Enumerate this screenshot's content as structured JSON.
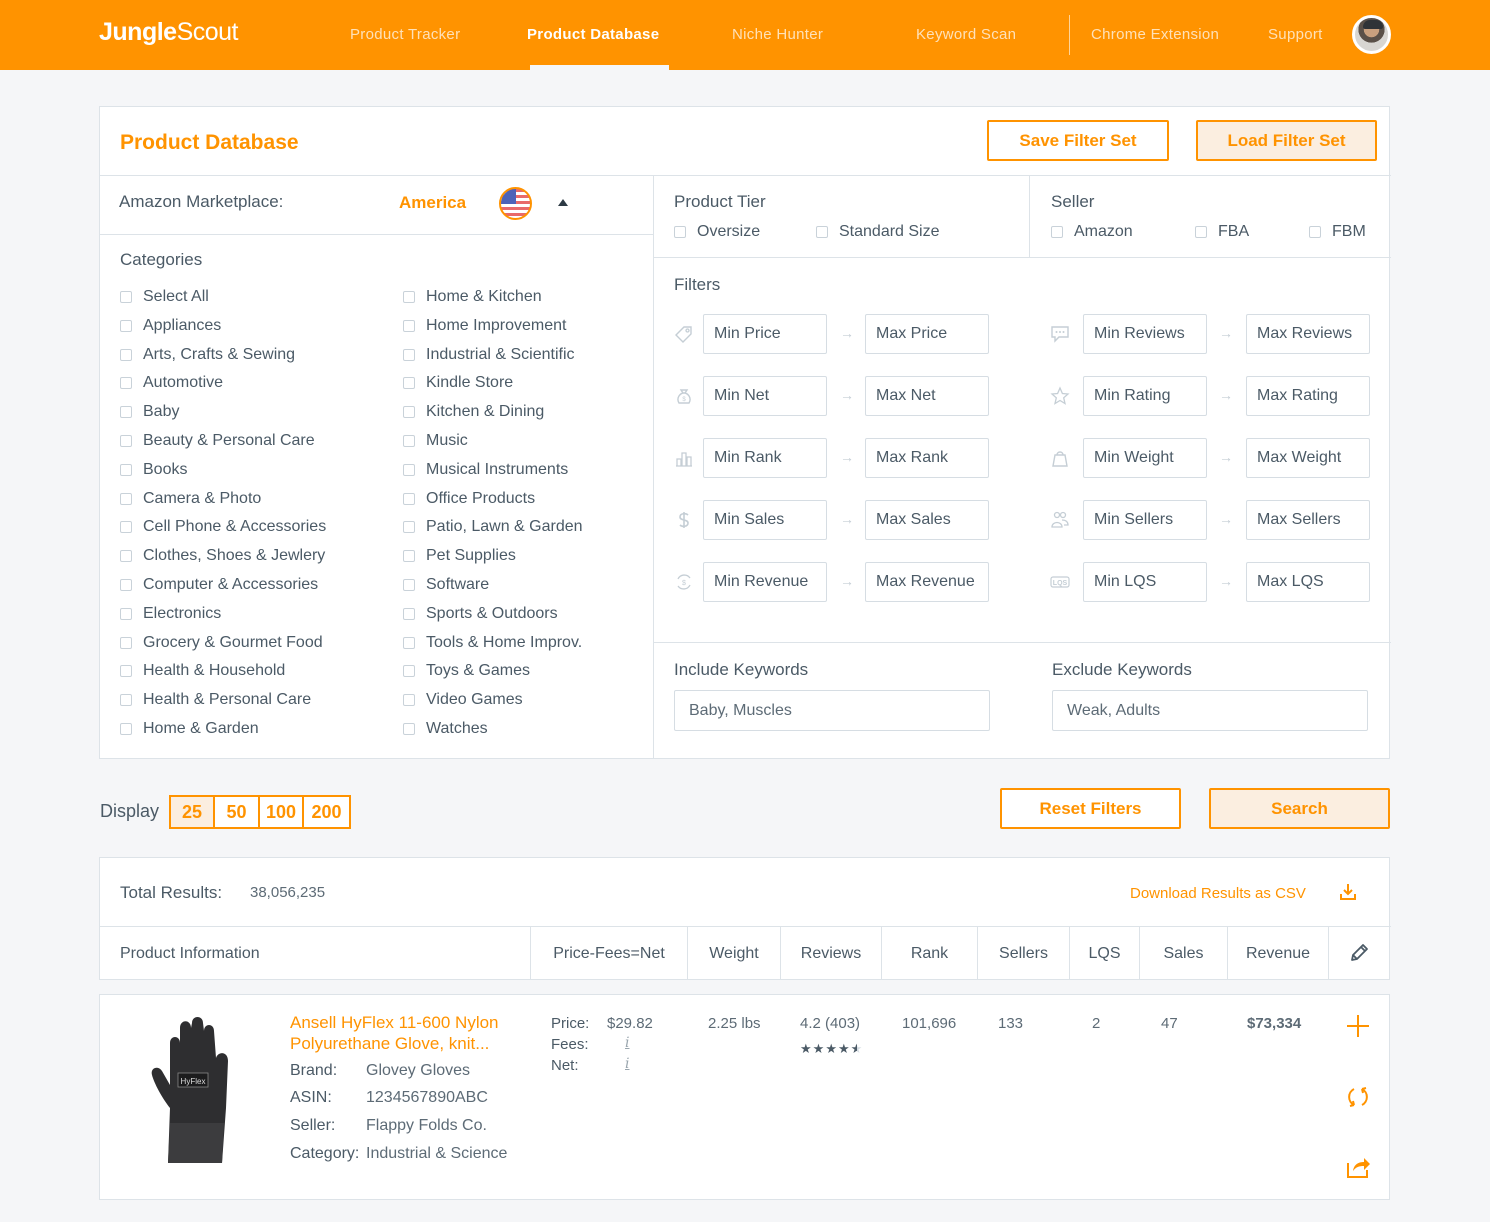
{
  "brand": {
    "logo_bold": "Jungle",
    "logo_light": "Scout",
    "accent": "#ff9300"
  },
  "nav": {
    "items": [
      {
        "label": "Product Tracker",
        "active": false
      },
      {
        "label": "Product Database",
        "active": true
      },
      {
        "label": "Niche Hunter",
        "active": false
      },
      {
        "label": "Keyword Scan",
        "active": false
      },
      {
        "label": "Chrome Extension",
        "active": false
      },
      {
        "label": "Support",
        "active": false
      }
    ],
    "avatar": "user-avatar"
  },
  "filters_panel": {
    "title": "Product Database",
    "save_label": "Save Filter Set",
    "load_label": "Load Filter Set",
    "marketplace_label": "Amazon Marketplace:",
    "marketplace_value": "America",
    "marketplace_flag": "us-flag-icon",
    "categories_title": "Categories",
    "categories_left": [
      "Select All",
      "Appliances",
      "Arts, Crafts & Sewing",
      "Automotive",
      "Baby",
      "Beauty & Personal Care",
      "Books",
      "Camera & Photo",
      "Cell Phone & Accessories",
      "Clothes, Shoes & Jewlery",
      "Computer & Accessories",
      "Electronics",
      "Grocery & Gourmet Food",
      "Health & Household",
      "Health & Personal Care",
      "Home & Garden"
    ],
    "categories_right": [
      "Home & Kitchen",
      "Home Improvement",
      "Industrial & Scientific",
      "Kindle Store",
      "Kitchen & Dining",
      "Music",
      "Musical Instruments",
      "Office Products",
      "Patio, Lawn & Garden",
      "Pet Supplies",
      "Software",
      "Sports & Outdoors",
      "Tools & Home Improv.",
      "Toys & Games",
      "Video Games",
      "Watches"
    ],
    "product_tier": {
      "title": "Product Tier",
      "options": [
        "Oversize",
        "Standard Size"
      ]
    },
    "seller": {
      "title": "Seller",
      "options": [
        "Amazon",
        "FBA",
        "FBM"
      ]
    },
    "filters_title": "Filters",
    "filters_left": [
      {
        "icon": "price-tag-icon",
        "min": "Min Price",
        "max": "Max Price"
      },
      {
        "icon": "money-bag-icon",
        "min": "Min Net",
        "max": "Max Net"
      },
      {
        "icon": "bar-chart-icon",
        "min": "Min Rank",
        "max": "Max Rank"
      },
      {
        "icon": "dollar-icon",
        "min": "Min Sales",
        "max": "Max Sales"
      },
      {
        "icon": "revenue-cycle-icon",
        "min": "Min Revenue",
        "max": "Max Revenue"
      }
    ],
    "filters_right": [
      {
        "icon": "chat-bubble-icon",
        "min": "Min Reviews",
        "max": "Max Reviews"
      },
      {
        "icon": "star-icon",
        "min": "Min Rating",
        "max": "Max Rating"
      },
      {
        "icon": "weight-icon",
        "min": "Min Weight",
        "max": "Max Weight"
      },
      {
        "icon": "users-icon",
        "min": "Min Sellers",
        "max": "Max Sellers"
      },
      {
        "icon": "lqs-icon",
        "min": "Min LQS",
        "max": "Max LQS"
      }
    ],
    "include_keywords": {
      "label": "Include Keywords",
      "value": "Baby, Muscles"
    },
    "exclude_keywords": {
      "label": "Exclude Keywords",
      "value": "Weak, Adults"
    }
  },
  "display": {
    "label": "Display",
    "options": [
      "25",
      "50",
      "100",
      "200"
    ],
    "selected": "25"
  },
  "actions": {
    "reset_label": "Reset Filters",
    "search_label": "Search"
  },
  "results": {
    "total_label": "Total Results:",
    "total_value": "38,056,235",
    "download_label": "Download Results as CSV",
    "columns": [
      "Product Information",
      "Price-Fees=Net",
      "Weight",
      "Reviews",
      "Rank",
      "Sellers",
      "LQS",
      "Sales",
      "Revenue"
    ],
    "rows": [
      {
        "title_line1": "Ansell HyFlex 11-600 Nylon",
        "title_line2": "Polyurethane Glove, knit...",
        "brand_key": "Brand:",
        "brand": "Glovey Gloves",
        "asin_key": "ASIN:",
        "asin": "1234567890ABC",
        "seller_key": "Seller:",
        "seller": "Flappy Folds Co.",
        "category_key": "Category:",
        "category": "Industrial & Science",
        "price_key": "Price:",
        "price": "$29.82",
        "fees_key": "Fees:",
        "fees": "i",
        "net_key": "Net:",
        "net": "i",
        "weight": "2.25 lbs",
        "reviews": "4.2 (403)",
        "rating_stars": 4.5,
        "rank": "101,696",
        "sellers": "133",
        "lqs": "2",
        "sales": "47",
        "revenue": "$73,334"
      }
    ]
  }
}
